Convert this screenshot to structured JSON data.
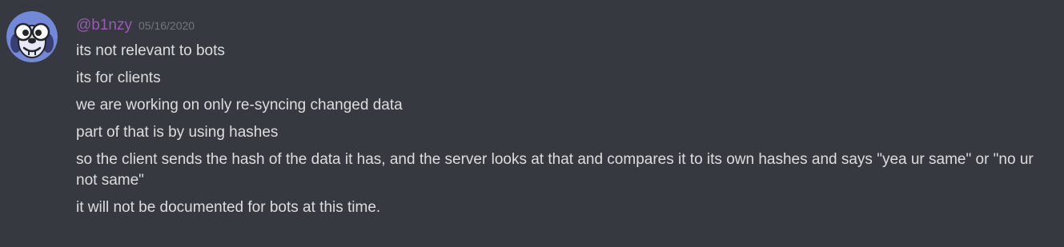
{
  "message": {
    "author": "@b1nzy",
    "timestamp": "05/16/2020",
    "author_color": "#9b59b6",
    "avatar_icon": "cartoon-dog-avatar",
    "lines": [
      "its not relevant to bots",
      "its for clients",
      "we are working on only re-syncing changed data",
      "part of that is by using hashes",
      "so the client sends the hash of the data it has, and the server looks at that and compares it to its own hashes and says \"yea ur same\" or \"no ur not same\"",
      "it will not be documented for bots at this time."
    ]
  },
  "colors": {
    "background": "#36393f",
    "text": "#dcddde",
    "timestamp": "#72767d",
    "avatar_bg": "#7289da"
  }
}
